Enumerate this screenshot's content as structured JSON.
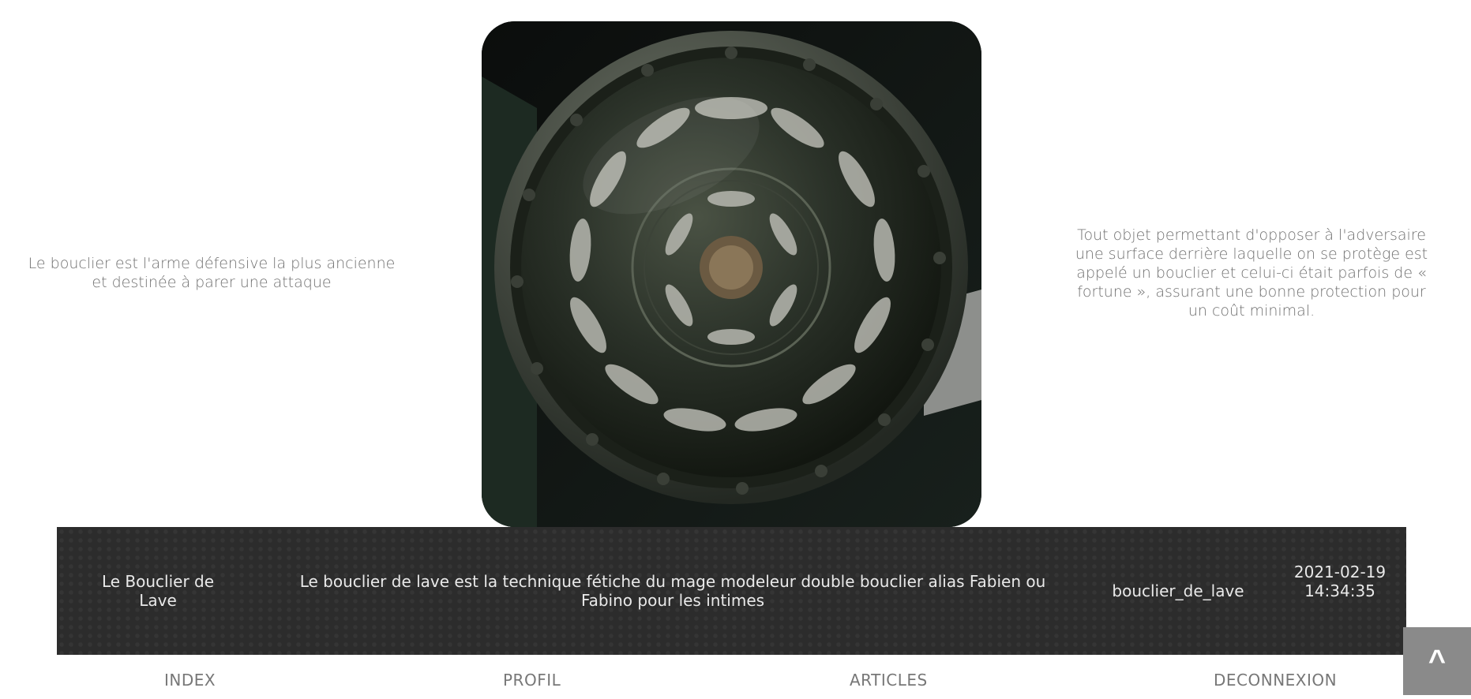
{
  "left_text": "Le bouclier est l'arme défensive la plus ancienne et destinée à parer une attaque",
  "right_text": "Tout objet permettant d'opposer à l'adversaire une surface derrière laquelle on se protège est appelé un bouclier et celui-ci était parfois de « fortune », assurant une bonne protection pour un coût minimal.",
  "image": {
    "subject": "bronze-shield"
  },
  "article": {
    "title": "Le Bouclier de Lave",
    "description": "Le bouclier de lave est la technique fétiche du mage modeleur double bouclier alias Fabien ou Fabino pour les intimes",
    "slug": "bouclier_de_lave",
    "date": "2021-02-19 14:34:35"
  },
  "nav": {
    "index": "INDEX",
    "profil": "PROFIL",
    "articles": "ARTICLES",
    "deconnexion": "DECONNEXION"
  },
  "back_to_top": {
    "label": "^"
  },
  "colors": {
    "bar_bg": "#2c2c2c",
    "bar_text": "#e9e9e9",
    "nav_text": "#777777",
    "back_to_top_bg": "#8a8a8a"
  }
}
